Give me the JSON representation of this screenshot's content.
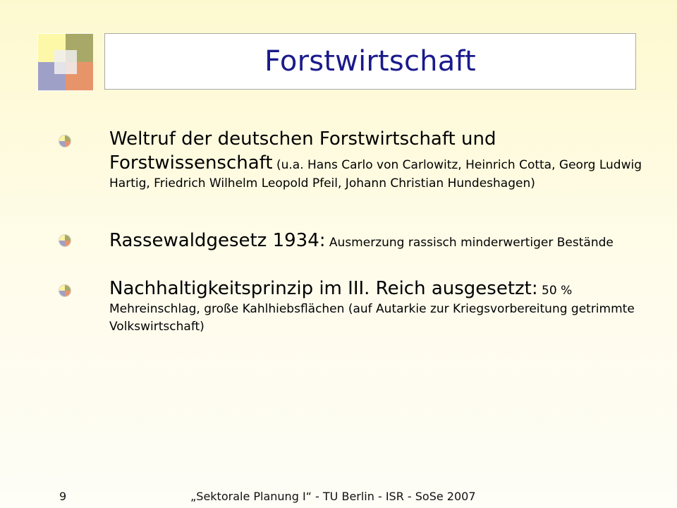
{
  "slide": {
    "title": "Forstwirtschaft",
    "bullets": [
      {
        "main": "Weltruf der deutschen Forstwirtschaft und Forstwissenschaft",
        "detail": " (u.a. Hans Carlo von Carlowitz, Heinrich Cotta, Georg Ludwig Hartig, Friedrich Wilhelm Leopold Pfeil, Johann Christian Hundeshagen)"
      },
      {
        "main": "Rassewaldgesetz 1934:",
        "detail": " Ausmerzung rassisch minderwertiger Bestände"
      },
      {
        "main": "Nachhaltigkeitsprinzip im III. Reich ausgesetzt:",
        "detail": " 50 % Mehreinschlag, große Kahlhiebsflächen (auf Autarkie zur Kriegsvorbereitung getrimmte Volkswirtschaft)"
      }
    ],
    "footer": {
      "page_number": "9",
      "text": "„Sektorale Planung I“  -  TU Berlin -  ISR -  SoSe 2007"
    }
  },
  "colors": {
    "title": "#1a1a8c",
    "logo_yellow": "#fdf8a8",
    "logo_olive": "#a8a868",
    "logo_blue": "#9ea0c8",
    "logo_orange": "#e8946a"
  }
}
